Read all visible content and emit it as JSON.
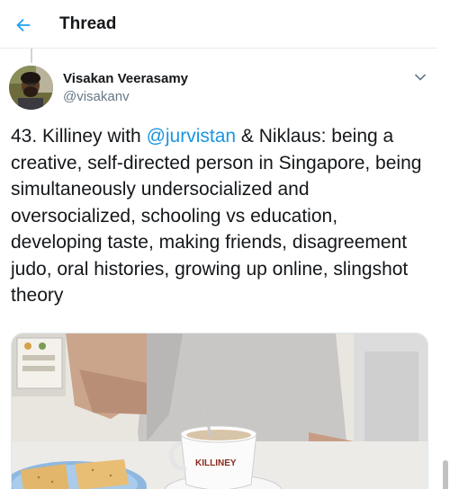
{
  "header": {
    "title": "Thread",
    "back_icon": "arrow-left-icon",
    "accent_color": "#1da1f2"
  },
  "tweet": {
    "author_name": "Visakan Veerasamy",
    "author_handle": "@visakanv",
    "text_before": "43. Killiney with ",
    "mention": "@jurvistan",
    "text_after": " & Niklaus: being a creative, self-directed person in Singapore, being simultaneously undersocialized and oversocialized, schooling vs education, developing taste, making friends, disagreement judo, oral histories, growing up online, slingshot theory",
    "media_cup_text": "KILLINEY"
  },
  "colors": {
    "link": "#1b95e0",
    "secondary_text": "#657786",
    "divider": "#e6ecf0"
  }
}
